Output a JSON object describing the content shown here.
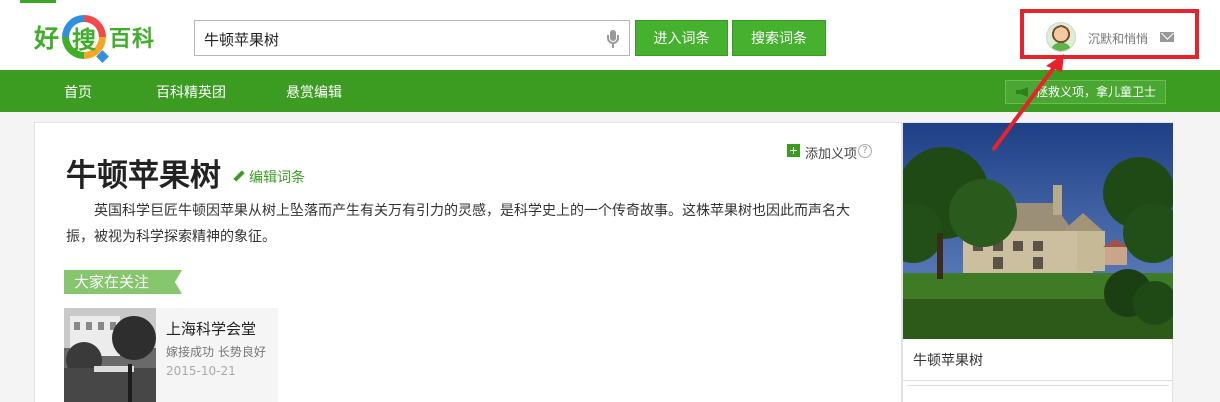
{
  "header": {
    "logo": {
      "left": "好",
      "middle": "搜",
      "right": "百科"
    },
    "search": {
      "value": "牛顿苹果树"
    },
    "buttons": {
      "enter": "进入词条",
      "search": "搜索词条"
    },
    "user": {
      "name": "沉默和悄悄"
    }
  },
  "nav": {
    "items": [
      "首页",
      "百科精英团",
      "悬赏编辑"
    ],
    "banner": "拯救义项，拿儿童卫士"
  },
  "article": {
    "title": "牛顿苹果树",
    "edit_label": "编辑词条",
    "add_meaning": "添加义项",
    "help": "?",
    "summary": "英国科学巨匠牛顿因苹果从树上坠落而产生有关万有引力的灵感，是科学史上的一个传奇故事。这株苹果树也因此而声名大振，被视为科学探索精神的象征。"
  },
  "focus": {
    "tag": "大家在关注",
    "card": {
      "title": "上海科学会堂",
      "subtitle": "嫁接成功 长势良好",
      "date": "2015-10-21"
    }
  },
  "image_card": {
    "caption": "牛顿苹果树"
  },
  "colors": {
    "brand_green": "#3b9c21",
    "button_green": "#46b02f",
    "highlight_red": "#e8222a"
  }
}
